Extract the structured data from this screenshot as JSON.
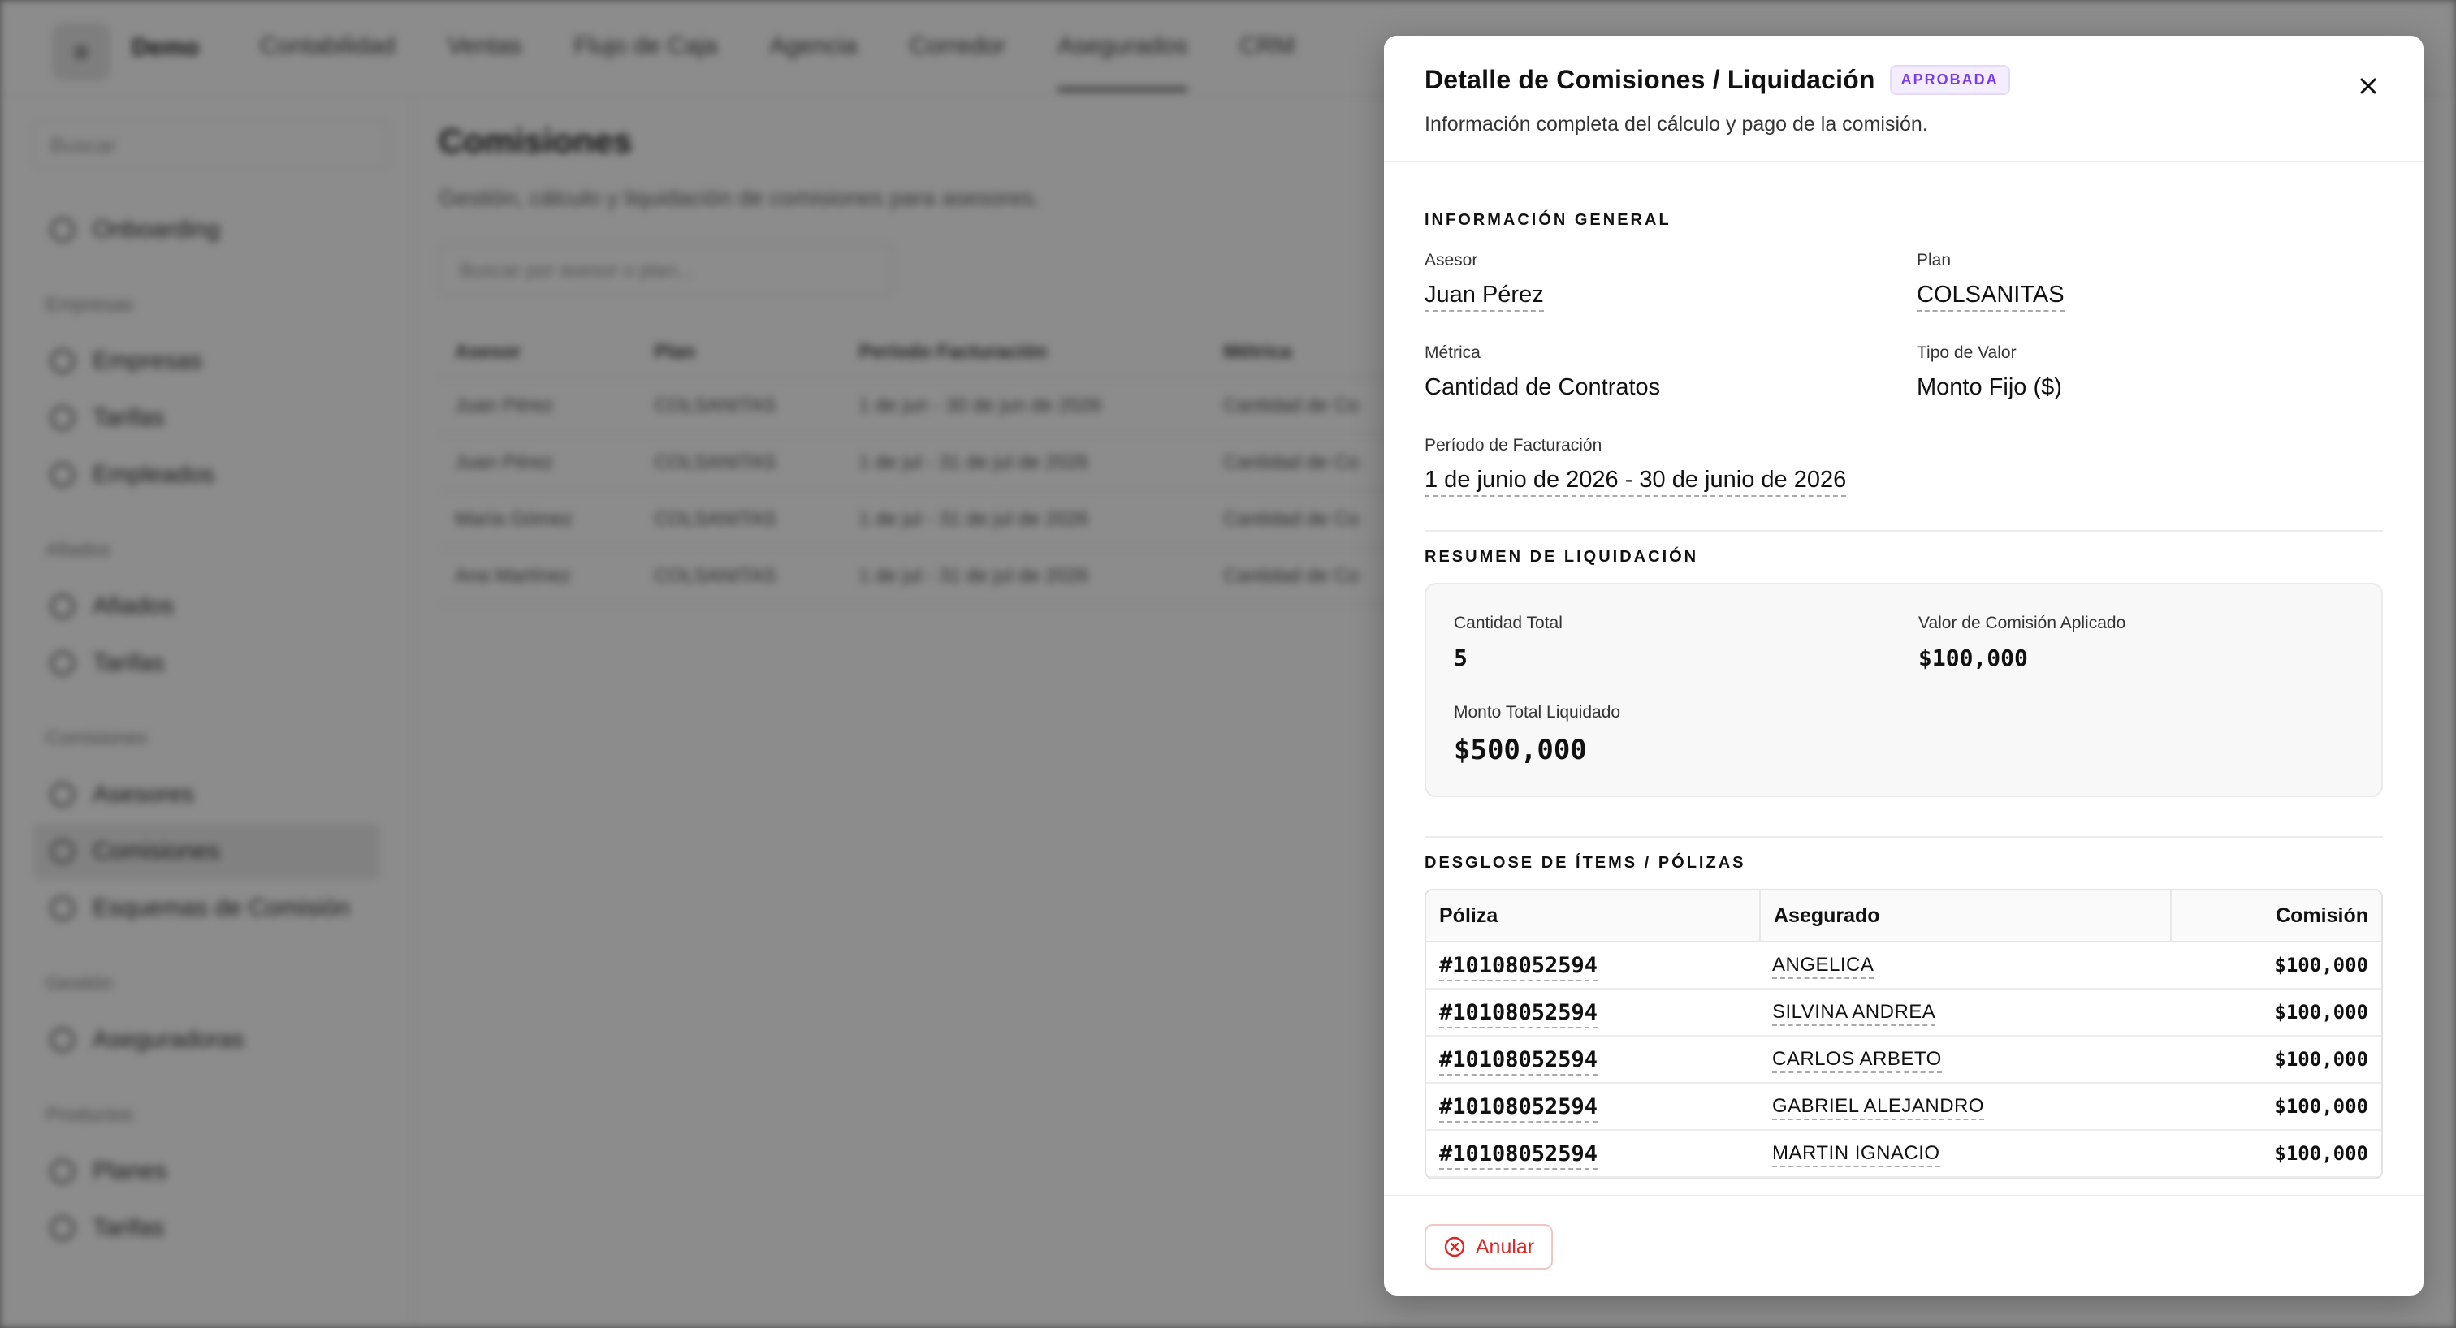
{
  "background_app": {
    "logo_glyph": "≡",
    "app_name": "Demo",
    "top_nav": [
      "Contabilidad",
      "Ventas",
      "Flujo de Caja",
      "Agencia",
      "Corredor",
      "Asegurados",
      "CRM"
    ],
    "active_nav": "Asegurados",
    "sidebar": {
      "search_placeholder": "Buscar",
      "top_item": "Onboarding",
      "sections": [
        {
          "title": "Empresas",
          "items": [
            "Empresas",
            "Tarifas",
            "Empleados"
          ]
        },
        {
          "title": "Afiados",
          "items": [
            "Afiados",
            "Tarifas"
          ]
        },
        {
          "title": "Comisiones",
          "items": [
            "Asesores",
            "Comisiones",
            "Esquemas de Comisión"
          ]
        },
        {
          "title": "Gestión",
          "items": [
            "Aseguradoras"
          ]
        },
        {
          "title": "Productos",
          "items": [
            "Planes",
            "Tarifas"
          ]
        }
      ],
      "active_item": "Comisiones"
    },
    "main": {
      "title": "Comisiones",
      "subtitle": "Gestión, cálculo y liquidación de comisiones para asesores.",
      "search_placeholder": "Buscar por asesor o plan...",
      "table_headers": [
        "Asesor",
        "Plan",
        "Período Facturación",
        "Métrica"
      ],
      "table_rows": [
        [
          "Juan Pérez",
          "COLSANITAS",
          "1 de jun - 30 de jun de 2026",
          "Cantidad de Co"
        ],
        [
          "Juan Pérez",
          "COLSANITAS",
          "1 de jul - 31 de jul de 2026",
          "Cantidad de Co"
        ],
        [
          "María Gómez",
          "COLSANITAS",
          "1 de jul - 31 de jul de 2026",
          "Cantidad de Co"
        ],
        [
          "Ana Martínez",
          "COLSANITAS",
          "1 de jul - 31 de jul de 2026",
          "Cantidad de Co"
        ]
      ]
    }
  },
  "modal": {
    "title": "Detalle de Comisiones / Liquidación",
    "status_badge": "APROBADA",
    "description": "Información completa del cálculo y pago de la comisión.",
    "general": {
      "section_title": "INFORMACIÓN GENERAL",
      "asesor_label": "Asesor",
      "asesor_value": "Juan Pérez",
      "plan_label": "Plan",
      "plan_value": "COLSANITAS",
      "metrica_label": "Métrica",
      "metrica_value": "Cantidad de Contratos",
      "tipo_label": "Tipo de Valor",
      "tipo_value": "Monto Fijo ($)",
      "periodo_label": "Período de Facturación",
      "periodo_value": "1 de junio de 2026 - 30 de junio de 2026"
    },
    "summary": {
      "section_title": "RESUMEN DE LIQUIDACIÓN",
      "cantidad_label": "Cantidad Total",
      "cantidad_value": "5",
      "valor_label": "Valor de Comisión Aplicado",
      "valor_value": "$100,000",
      "monto_label": "Monto Total Liquidado",
      "monto_value": "$500,000"
    },
    "items": {
      "section_title": "DESGLOSE DE ÍTEMS / PÓLIZAS",
      "headers": [
        "Póliza",
        "Asegurado",
        "Comisión"
      ],
      "rows": [
        {
          "poliza": "#10108052594",
          "asegurado": "ANGELICA",
          "comision": "$100,000"
        },
        {
          "poliza": "#10108052594",
          "asegurado": "SILVINA ANDREA",
          "comision": "$100,000"
        },
        {
          "poliza": "#10108052594",
          "asegurado": "CARLOS ARBETO",
          "comision": "$100,000"
        },
        {
          "poliza": "#10108052594",
          "asegurado": "GABRIEL ALEJANDRO",
          "comision": "$100,000"
        },
        {
          "poliza": "#10108052594",
          "asegurado": "MARTIN IGNACIO",
          "comision": "$100,000"
        }
      ]
    },
    "footer": {
      "anular_label": "Anular"
    }
  },
  "colors": {
    "badge_purple": "#7c3aed",
    "danger_red": "#dc2626",
    "overlay": "rgba(0,0,0,0.45)"
  },
  "icons": {
    "close": "close-icon",
    "anular": "x-circle-icon"
  }
}
